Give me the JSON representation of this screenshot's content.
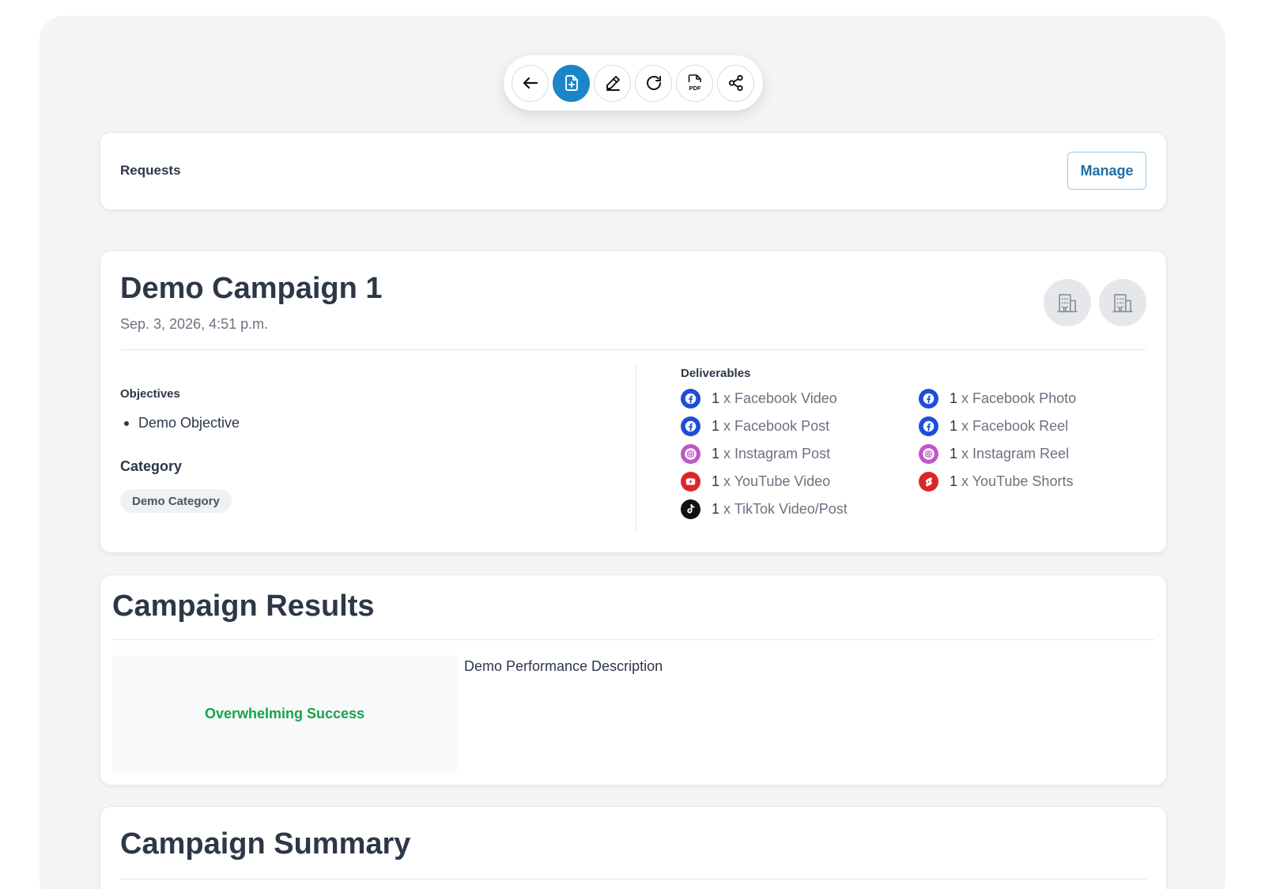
{
  "toolbar": {
    "buttons": [
      {
        "icon": "arrow-left-icon",
        "active": false
      },
      {
        "icon": "file-add-icon",
        "active": true
      },
      {
        "icon": "pencil-icon",
        "active": false
      },
      {
        "icon": "refresh-icon",
        "active": false
      },
      {
        "icon": "pdf-icon",
        "active": false
      },
      {
        "icon": "share-icon",
        "active": false
      }
    ],
    "pdf_text": "PDF",
    "accent_color": "#1a86c8"
  },
  "requests": {
    "label": "Requests",
    "manage_label": "Manage"
  },
  "campaign": {
    "title": "Demo Campaign 1",
    "date": "Sep. 3, 2026, 4:51 p.m.",
    "brand_icons": [
      "building-icon",
      "building-icon"
    ],
    "objectives_label": "Objectives",
    "objectives": [
      "Demo Objective"
    ],
    "category_label": "Category",
    "category": "Demo Category",
    "deliverables_label": "Deliverables",
    "deliverables": [
      {
        "count": "1",
        "text": "x Facebook Video",
        "icon": "facebook-icon"
      },
      {
        "count": "1",
        "text": "x Facebook Photo",
        "icon": "facebook-icon"
      },
      {
        "count": "1",
        "text": "x Facebook Post",
        "icon": "facebook-icon"
      },
      {
        "count": "1",
        "text": "x Facebook Reel",
        "icon": "facebook-icon"
      },
      {
        "count": "1",
        "text": "x Instagram Post",
        "icon": "instagram-icon"
      },
      {
        "count": "1",
        "text": "x Instagram Reel",
        "icon": "instagram-icon"
      },
      {
        "count": "1",
        "text": "x YouTube Video",
        "icon": "youtube-icon"
      },
      {
        "count": "1",
        "text": "x YouTube Shorts",
        "icon": "youtube-shorts-icon"
      },
      {
        "count": "1",
        "text": "x TikTok Video/Post",
        "icon": "tiktok-icon"
      }
    ]
  },
  "results": {
    "title": "Campaign Results",
    "rating": "Overwhelming Success",
    "rating_color": "#16a34a",
    "description": "Demo Performance Description"
  },
  "summary": {
    "title": "Campaign Summary"
  }
}
